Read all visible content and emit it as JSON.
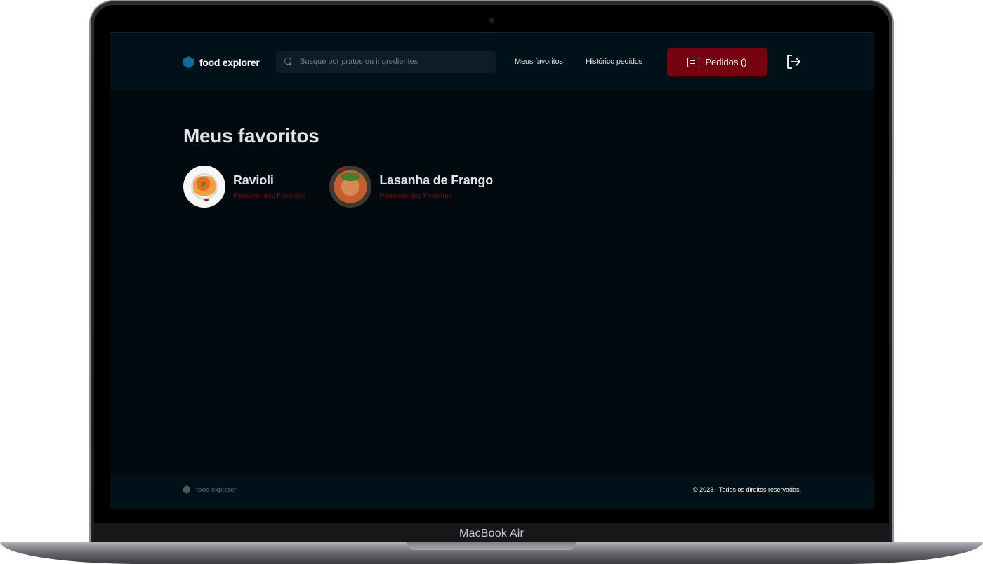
{
  "device": {
    "label": "MacBook Air"
  },
  "header": {
    "brand": "food explorer",
    "search_placeholder": "Busque por pratos ou ingredientes",
    "nav": {
      "favorites": "Meus favoritos",
      "history": "Histórico pedidos"
    },
    "orders_label": "Pedidos ()"
  },
  "main": {
    "title": "Meus favoritos",
    "favorites": [
      {
        "name": "Ravioli",
        "remove_label": "Remover dos Favoritos"
      },
      {
        "name": "Lasanha de Frango",
        "remove_label": "Remover dos Favoritos"
      }
    ]
  },
  "footer": {
    "brand": "food explorer",
    "copyright": "© 2023 - Todos os direitos reservados."
  },
  "colors": {
    "background": "#000a0f",
    "header_bg": "#00111a",
    "accent_button": "#750310",
    "remove_link": "#92000e",
    "brand_icon": "#0e6aa0"
  },
  "icons": [
    "hexagon-logo-icon",
    "search-icon",
    "receipt-icon",
    "sign-out-icon"
  ]
}
